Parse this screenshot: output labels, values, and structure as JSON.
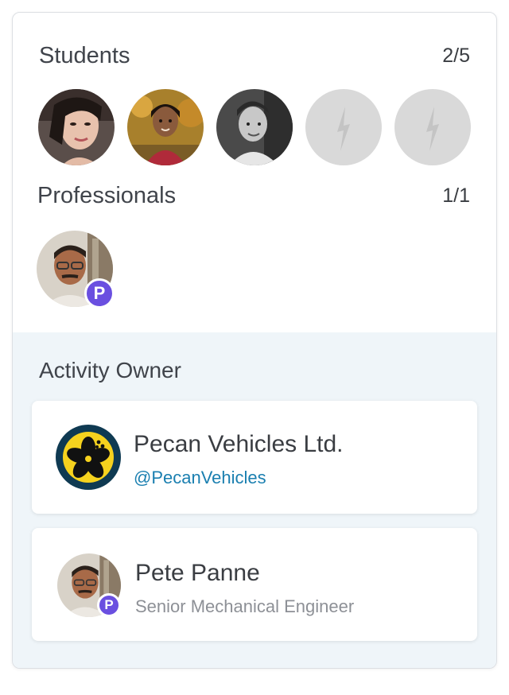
{
  "students": {
    "title": "Students",
    "count": "2/5",
    "members": [
      {
        "name": "student-1"
      },
      {
        "name": "student-2"
      },
      {
        "name": "student-3"
      }
    ],
    "empty_slot_icon": "lightning-bolt-icon"
  },
  "professionals": {
    "title": "Professionals",
    "count": "1/1",
    "badge_label": "P"
  },
  "activity_owner": {
    "title": "Activity Owner",
    "organization": {
      "name": "Pecan Vehicles Ltd.",
      "handle": "@PecanVehicles",
      "logo_icon": "hibiscus-logo-icon"
    },
    "person": {
      "name": "Pete Panne",
      "role": "Senior Mechanical Engineer",
      "badge_label": "P"
    }
  },
  "colors": {
    "badge": "#6a4fe0",
    "handle_link": "#1a7fb0",
    "owner_bg": "#eff5f9",
    "empty_slot": "#d9d9d9"
  }
}
